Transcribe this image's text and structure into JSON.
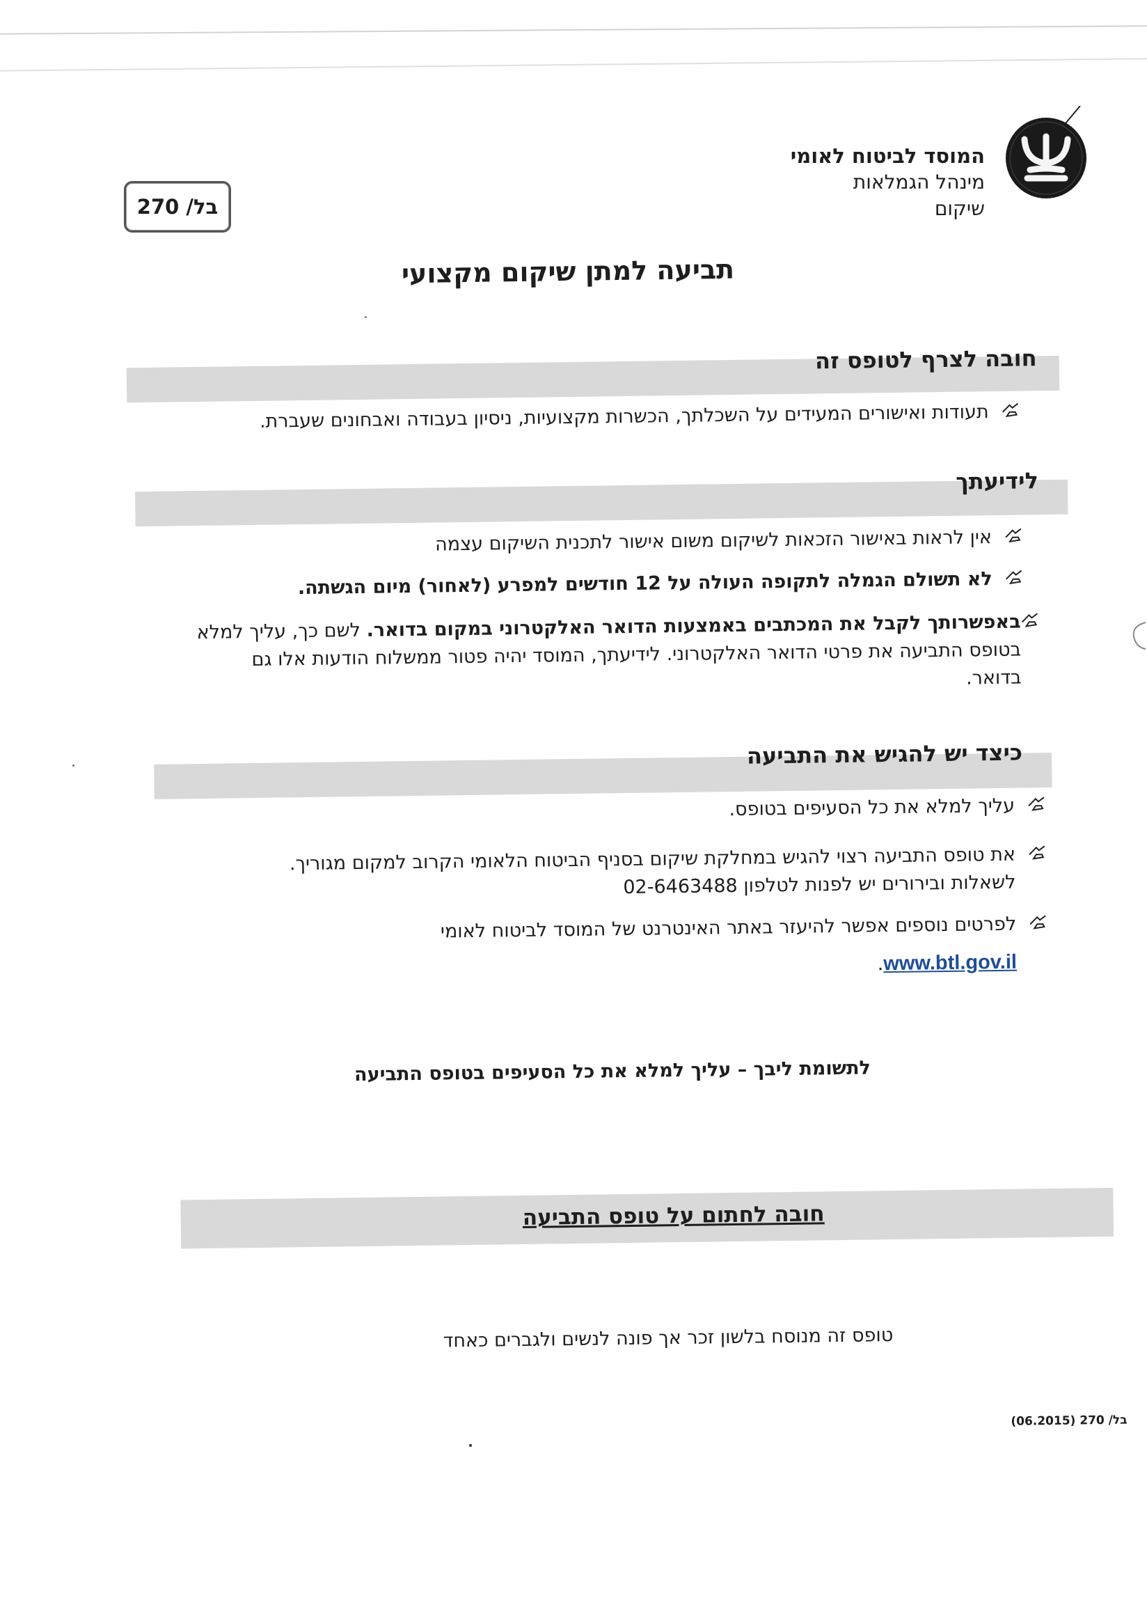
{
  "header": {
    "org_name": "המוסד לביטוח לאומי",
    "division": "מינהל הגמלאות",
    "department": "שיקום",
    "form_number": "בל/ 270",
    "logo_icon": "btl-logo-icon"
  },
  "title": "תביעה למתן שיקום מקצועי",
  "sections": {
    "attach": {
      "title": "חובה לצרף לטופס זה",
      "items": [
        "תעודות ואישורים המעידים על השכלתך, הכשרות מקצועיות, ניסיון בעבודה ואבחונים שעברת."
      ]
    },
    "info": {
      "title": "לידיעתך",
      "item1": "אין לראות באישור הזכאות לשיקום משום אישור לתכנית השיקום עצמה",
      "item2": "לא תשולם הגמלה לתקופה העולה על 12 חודשים למפרע (לאחור) מיום הגשתה.",
      "item3_bold": "באפשרותך לקבל את המכתבים באמצעות הדואר האלקטרוני במקום בדואר.",
      "item3_rest": " לשם כך, עליך למלא בטופס התביעה את פרטי הדואר האלקטרוני. לידיעתך, המוסד יהיה פטור ממשלוח הודעות אלו גם בדואר."
    },
    "submit": {
      "title": "כיצד יש להגיש את התביעה",
      "item1": "עליך למלא את כל הסעיפים בטופס.",
      "item2_line1": "את טופס התביעה רצוי להגיש במחלקת שיקום בסניף הביטוח הלאומי הקרוב למקום מגוריך.",
      "item2_line2": "לשאלות ובירורים יש לפנות לטלפון 02-6463488",
      "item3_text": "לפרטים נוספים אפשר להיעזר באתר האינטרנט של המוסד לביטוח לאומי ",
      "item3_link": "www.btl.gov.il",
      "item3_end": "."
    }
  },
  "attention": "לתשומת ליבך – עליך למלא את כל הסעיפים בטופס התביעה",
  "sign_title": "חובה לחתום על טופס התביעה",
  "gender_note": "טופס זה מנוסח בלשון זכר אך פונה לנשים ולגברים כאחד",
  "footer_code": "בל/ 270  (06.2015)",
  "colors": {
    "section_bar": "#d9d9d9",
    "link": "#1f4e99",
    "text": "#1e1e1e"
  }
}
